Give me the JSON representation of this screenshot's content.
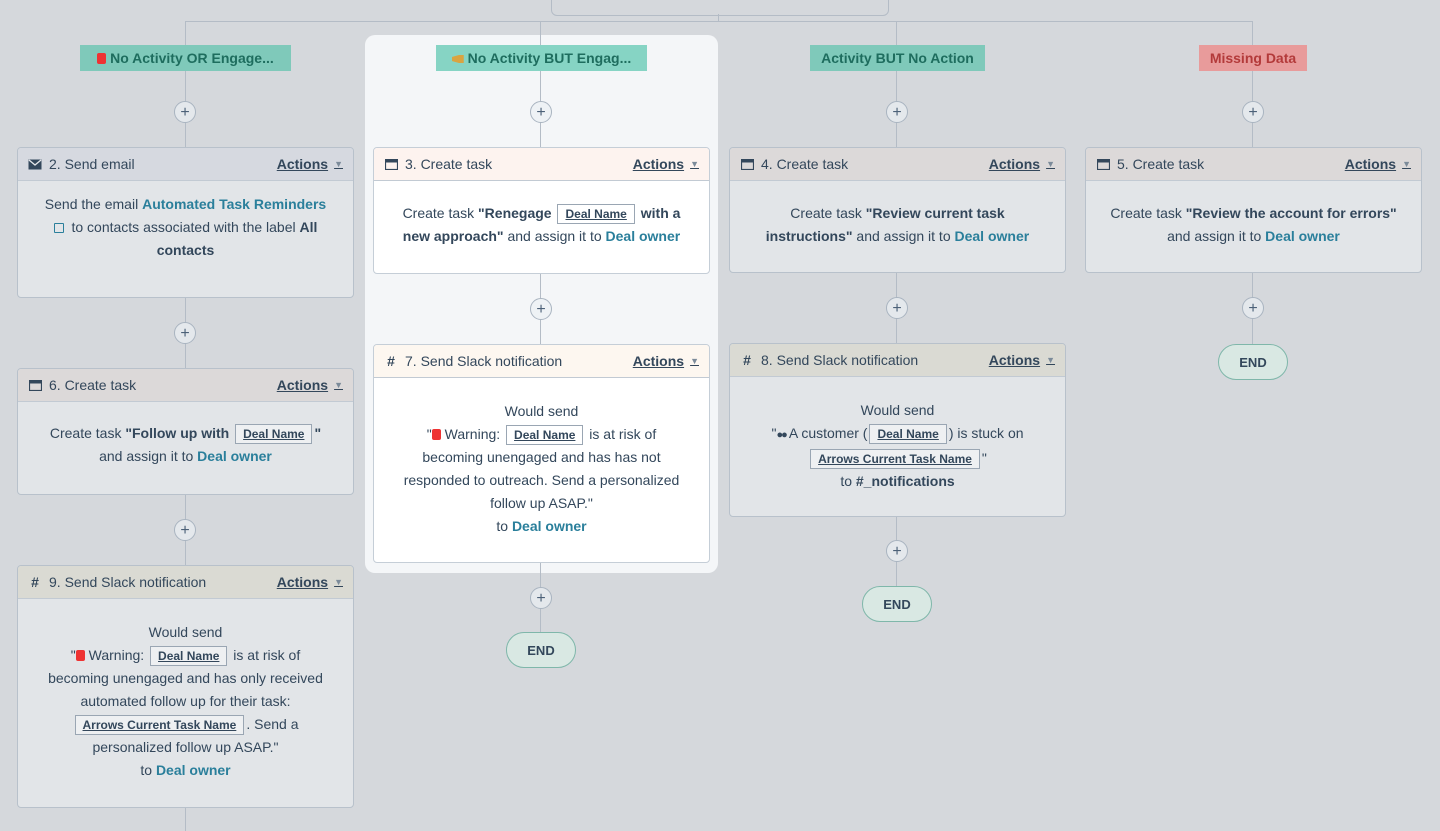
{
  "branches": [
    {
      "label": "No Activity OR Engage..."
    },
    {
      "label": "No Activity BUT Engag..."
    },
    {
      "label": "Activity BUT No Action"
    },
    {
      "label": "Missing Data"
    }
  ],
  "actions_label": "Actions",
  "end_label": "END",
  "plus": "+",
  "cards": {
    "c2": {
      "title": "2. Send email",
      "p1": "Send the email ",
      "link": "Automated Task Reminders",
      "p2": " to contacts associated with the label ",
      "bold": "All contacts"
    },
    "c6": {
      "title": "6. Create task",
      "p1": "Create task ",
      "q1": "\"Follow up with ",
      "token": "Deal Name",
      "q2": "\"",
      "p2": " and assign it to ",
      "owner": "Deal owner"
    },
    "c9": {
      "title": "9. Send Slack notification",
      "would": "Would send",
      "q_open": "\"",
      "warn": " Warning: ",
      "token1": "Deal Name",
      "t1": " is at risk of becoming unengaged and has only received automated follow up for their task: ",
      "token2": "Arrows Current Task Name",
      "t2": ". Send a personalized follow up ASAP.\"",
      "to": "to ",
      "owner": "Deal owner"
    },
    "c3": {
      "title": "3. Create task",
      "p1": "Create task ",
      "q1": "\"Renegage ",
      "token": "Deal Name",
      "q2": " with a new approach\"",
      "p2": " and assign it to ",
      "owner": "Deal owner"
    },
    "c7": {
      "title": "7. Send Slack notification",
      "would": "Would send",
      "q_open": "\"",
      "warn": " Warning: ",
      "token": "Deal Name",
      "t1": " is at risk of becoming unengaged and has has not responded to outreach. Send a personalized follow up ASAP.\"",
      "to": "to ",
      "owner": "Deal owner"
    },
    "c4": {
      "title": "4. Create task",
      "p1": "Create task ",
      "q": "\"Review current task instructions\"",
      "p2": " and assign it to ",
      "owner": "Deal owner"
    },
    "c8": {
      "title": "8. Send Slack notification",
      "would": "Would send",
      "q_open": "\"",
      "t1": " A customer (",
      "token1": "Deal Name",
      "t2": ") is stuck on",
      "token2": "Arrows Current Task Name",
      "t3": "\"",
      "to": "to ",
      "channel": "#_notifications"
    },
    "c5": {
      "title": "5. Create task",
      "p1": "Create task ",
      "q": "\"Review the account for errors\"",
      "p2": " and assign it to ",
      "owner": "Deal owner"
    }
  }
}
